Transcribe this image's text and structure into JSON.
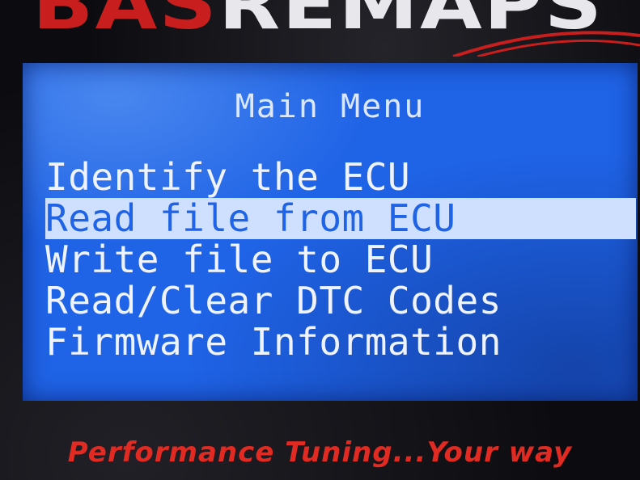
{
  "brand": {
    "logo_part_a": "BAS",
    "logo_part_b": "REMAPS"
  },
  "screen": {
    "title": "Main Menu",
    "menu_items": [
      {
        "label": "Identify the ECU",
        "selected": false
      },
      {
        "label": "Read file from ECU",
        "selected": true
      },
      {
        "label": "Write file to ECU",
        "selected": false
      },
      {
        "label": "Read/Clear DTC Codes",
        "selected": false
      },
      {
        "label": "Firmware Information",
        "selected": false
      }
    ]
  },
  "tagline": "Performance Tuning...Your way",
  "colors": {
    "lcd_background": "#1f63e6",
    "lcd_text": "#eef3ff",
    "selection_highlight": "#cfe0ff",
    "brand_red": "#c81e1e",
    "tagline_red": "#e02a22"
  }
}
